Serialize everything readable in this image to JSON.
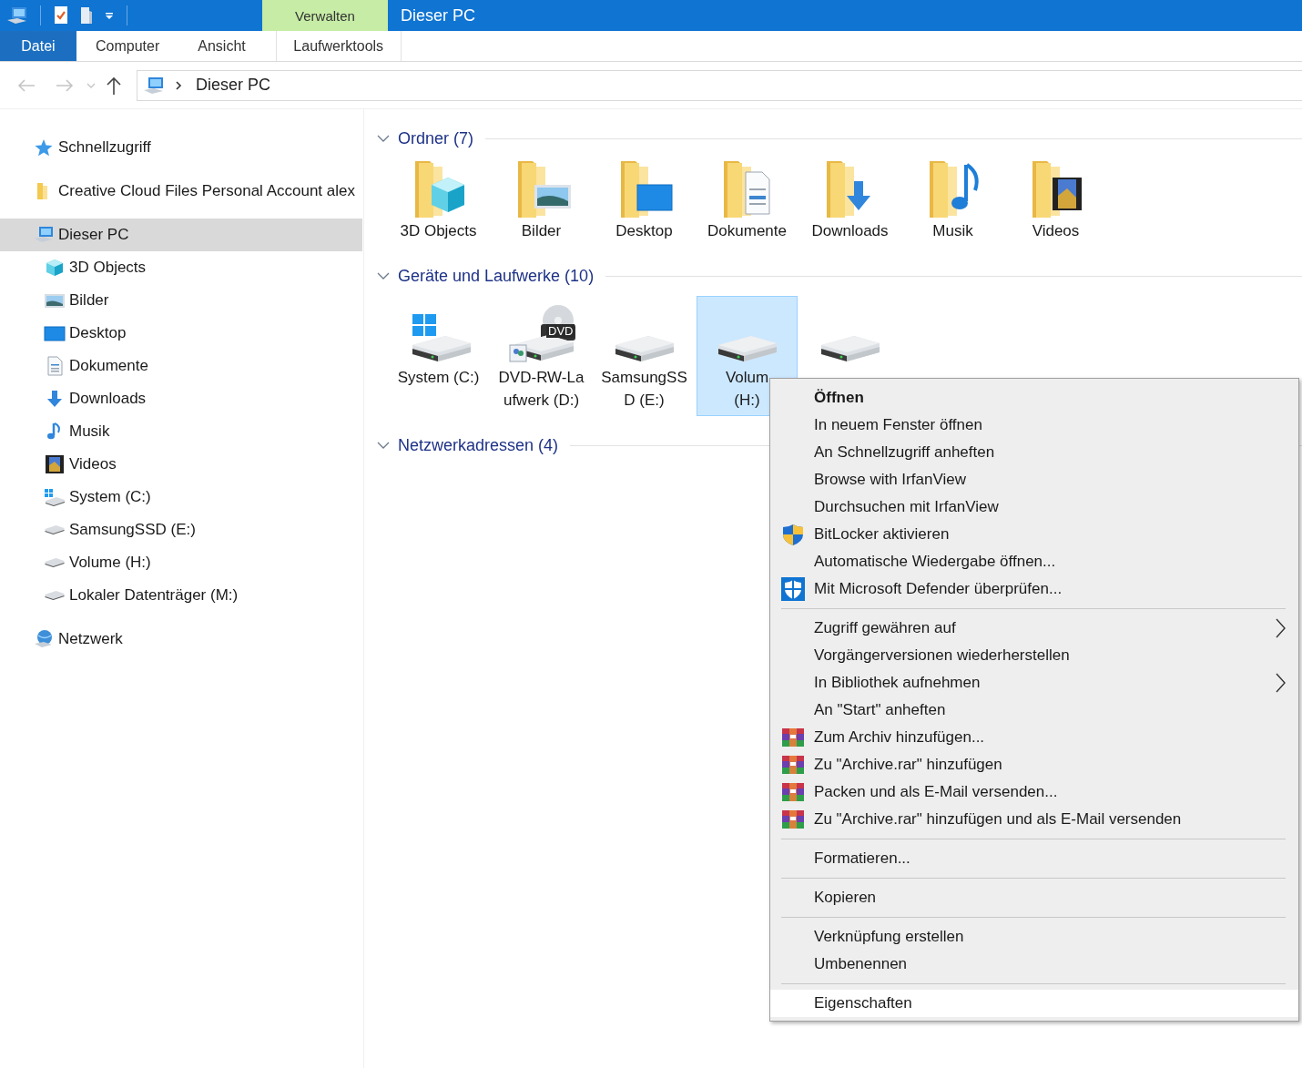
{
  "window": {
    "title": "Dieser PC",
    "context_group": "Verwalten"
  },
  "ribbon": {
    "tabs": [
      {
        "label": "Datei",
        "kind": "file",
        "selected": false
      },
      {
        "label": "Computer",
        "kind": "tab",
        "selected": false
      },
      {
        "label": "Ansicht",
        "kind": "tab",
        "selected": false
      },
      {
        "label": "Laufwerktools",
        "kind": "context",
        "selected": false
      }
    ]
  },
  "address_bar": {
    "path": [
      "Dieser PC"
    ]
  },
  "sidebar": {
    "items": [
      {
        "label": "Schnellzugriff",
        "selected": false
      },
      {
        "label": "Creative Cloud Files Personal Account alex",
        "selected": false
      },
      {
        "label": "Dieser PC",
        "selected": true,
        "children": [
          {
            "label": "3D Objects",
            "selected": false
          },
          {
            "label": "Bilder",
            "selected": false
          },
          {
            "label": "Desktop",
            "selected": false
          },
          {
            "label": "Dokumente",
            "selected": false
          },
          {
            "label": "Downloads",
            "selected": false
          },
          {
            "label": "Musik",
            "selected": false
          },
          {
            "label": "Videos",
            "selected": false
          },
          {
            "label": "System (C:)",
            "selected": false
          },
          {
            "label": "SamsungSSD (E:)",
            "selected": false
          },
          {
            "label": "Volume (H:)",
            "selected": false
          },
          {
            "label": "Lokaler Datenträger (M:)",
            "selected": false
          }
        ]
      },
      {
        "label": "Netzwerk",
        "selected": false
      }
    ]
  },
  "sections": [
    {
      "title": "Ordner (7)",
      "kind": "folders",
      "items": [
        {
          "label": "3D Objects",
          "selected": false
        },
        {
          "label": "Bilder",
          "selected": false
        },
        {
          "label": "Desktop",
          "selected": false
        },
        {
          "label": "Dokumente",
          "selected": false
        },
        {
          "label": "Downloads",
          "selected": false
        },
        {
          "label": "Musik",
          "selected": false
        },
        {
          "label": "Videos",
          "selected": false
        }
      ]
    },
    {
      "title": "Geräte und Laufwerke (10)",
      "kind": "drives",
      "items": [
        {
          "label": "System (C:)",
          "selected": false
        },
        {
          "label": "DVD-RW-Laufwerk (D:)",
          "badge": "DVD",
          "selected": false
        },
        {
          "label": "SamsungSSD (E:)",
          "selected": false
        },
        {
          "label": "Volum (H:)",
          "selected": true
        },
        {
          "selected": false
        }
      ]
    },
    {
      "title": "Netzwerkadressen (4)"
    }
  ],
  "context_menu": {
    "groups": [
      [
        {
          "label": "Öffnen",
          "bold": true,
          "submenu": false,
          "selected": false
        },
        {
          "label": "In neuem Fenster öffnen",
          "bold": false,
          "submenu": false,
          "selected": false
        },
        {
          "label": "An Schnellzugriff anheften",
          "bold": false,
          "submenu": false,
          "selected": false
        },
        {
          "label": "Browse with IrfanView",
          "bold": false,
          "submenu": false,
          "selected": false
        },
        {
          "label": "Durchsuchen mit IrfanView",
          "bold": false,
          "submenu": false,
          "selected": false
        },
        {
          "label": "BitLocker aktivieren",
          "bold": false,
          "submenu": false,
          "selected": false
        },
        {
          "label": "Automatische Wiedergabe öffnen...",
          "bold": false,
          "submenu": false,
          "selected": false
        },
        {
          "label": "Mit Microsoft Defender überprüfen...",
          "bold": false,
          "submenu": false,
          "selected": false
        }
      ],
      [
        {
          "label": "Zugriff gewähren auf",
          "bold": false,
          "submenu": true,
          "selected": false
        },
        {
          "label": "Vorgängerversionen wiederherstellen",
          "bold": false,
          "submenu": false,
          "selected": false
        },
        {
          "label": "In Bibliothek aufnehmen",
          "bold": false,
          "submenu": true,
          "selected": false
        },
        {
          "label": "An \"Start\" anheften",
          "bold": false,
          "submenu": false,
          "selected": false
        },
        {
          "label": "Zum Archiv hinzufügen...",
          "bold": false,
          "submenu": false,
          "selected": false
        },
        {
          "label": "Zu \"Archive.rar\" hinzufügen",
          "bold": false,
          "submenu": false,
          "selected": false
        },
        {
          "label": "Packen und als E-Mail versenden...",
          "bold": false,
          "submenu": false,
          "selected": false
        },
        {
          "label": "Zu \"Archive.rar\" hinzufügen und als E-Mail versenden",
          "bold": false,
          "submenu": false,
          "selected": false
        }
      ],
      [
        {
          "label": "Formatieren...",
          "bold": false,
          "submenu": false,
          "selected": false
        }
      ],
      [
        {
          "label": "Kopieren",
          "bold": false,
          "submenu": false,
          "selected": false
        }
      ],
      [
        {
          "label": "Verknüpfung erstellen",
          "bold": false,
          "submenu": false,
          "selected": false
        },
        {
          "label": "Umbenennen",
          "bold": false,
          "submenu": false,
          "selected": false
        }
      ],
      [
        {
          "label": "Eigenschaften",
          "bold": false,
          "submenu": false,
          "selected": true
        }
      ]
    ]
  }
}
